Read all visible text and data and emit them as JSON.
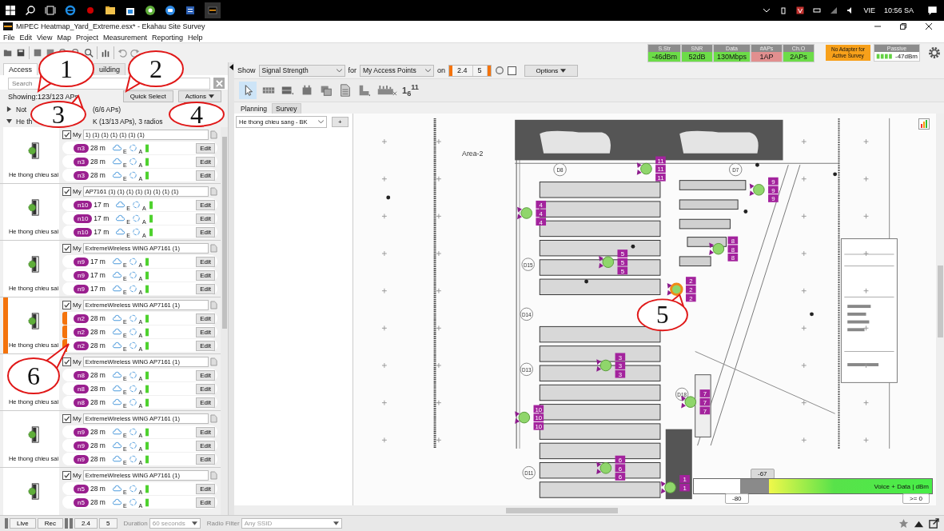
{
  "taskbar": {
    "language": "VIE",
    "clock": "10:56 SA"
  },
  "window": {
    "title": "MIPEC Heatmap_Yard_Extreme.esx* - Ekahau Site Survey"
  },
  "menu": [
    "File",
    "Edit",
    "View",
    "Map",
    "Project",
    "Measurement",
    "Reporting",
    "Help"
  ],
  "status_meters": [
    {
      "label": "S.Str",
      "value": "-46dBm",
      "color": "#6cdc48"
    },
    {
      "label": "SNR",
      "value": "52dB",
      "color": "#6cdc48"
    },
    {
      "label": "Data",
      "value": "130Mbps",
      "color": "#6cdc48"
    },
    {
      "label": "#APs",
      "value": "1AP",
      "color": "#e28f8f"
    },
    {
      "label": "Ch.O",
      "value": "2APs",
      "color": "#6cdc48"
    }
  ],
  "adapter_notice": "No Adapter for Active Survey",
  "passive": {
    "label": "Passive",
    "value": "-47dBm"
  },
  "left_panel": {
    "tabs": [
      {
        "label": "Access",
        "selected": true
      },
      {
        "label": "uilding",
        "selected": false
      }
    ],
    "search": {
      "placeholder": "Search"
    },
    "showing": "Showing:123/123 APs",
    "buttons": [
      "Quick Select",
      "Actions"
    ],
    "groups": [
      {
        "label_start": "Not",
        "label_end": "(6/6 APs)",
        "expanded": false
      },
      {
        "label_start": "He th",
        "label_end": "K (13/13 APs), 3 radios",
        "expanded": true
      }
    ],
    "aps": [
      {
        "caption": "He thong chieu sai",
        "checked": true,
        "my": "My",
        "name": "1) (1) (1) (1) (1) (1) (1)",
        "highlighted": false,
        "radios": [
          {
            "channel": "n3",
            "distance": "28 m",
            "e": "E",
            "a": "A",
            "edit": "Edit"
          },
          {
            "channel": "n3",
            "distance": "28 m",
            "e": "E",
            "a": "A",
            "edit": "Edit"
          },
          {
            "channel": "n3",
            "distance": "28 m",
            "e": "E",
            "a": "A",
            "edit": "Edit"
          }
        ]
      },
      {
        "caption": "He thong chieu sai",
        "checked": true,
        "my": "My",
        "name": "AP7161 (1) (1) (1) (1) (1) (1) (1) (1)",
        "highlighted": false,
        "radios": [
          {
            "channel": "n10",
            "distance": "17 m",
            "e": "E",
            "a": "A",
            "edit": "Edit"
          },
          {
            "channel": "n10",
            "distance": "17 m",
            "e": "E",
            "a": "A",
            "edit": "Edit"
          },
          {
            "channel": "n10",
            "distance": "17 m",
            "e": "E",
            "a": "A",
            "edit": "Edit"
          }
        ]
      },
      {
        "caption": "He thong chieu sai",
        "checked": true,
        "my": "My",
        "name": "ExtremeWireless WiNG AP7161 (1)",
        "highlighted": false,
        "radios": [
          {
            "channel": "n9",
            "distance": "17 m",
            "e": "E",
            "a": "A",
            "edit": "Edit"
          },
          {
            "channel": "n9",
            "distance": "17 m",
            "e": "E",
            "a": "A",
            "edit": "Edit"
          },
          {
            "channel": "n9",
            "distance": "17 m",
            "e": "E",
            "a": "A",
            "edit": "Edit"
          }
        ]
      },
      {
        "caption": "He thong chieu sai",
        "checked": true,
        "my": "My",
        "name": "ExtremeWireless WiNG AP7161 (1)",
        "highlighted": true,
        "radios": [
          {
            "channel": "n2",
            "distance": "28 m",
            "e": "E",
            "a": "A",
            "edit": "Edit"
          },
          {
            "channel": "n2",
            "distance": "28 m",
            "e": "E",
            "a": "A",
            "edit": "Edit"
          },
          {
            "channel": "n2",
            "distance": "28 m",
            "e": "E",
            "a": "A",
            "edit": "Edit"
          }
        ]
      },
      {
        "caption": "He thong chieu sai",
        "checked": true,
        "my": "My",
        "name": "ExtremeWireless WiNG AP7161 (1)",
        "highlighted": false,
        "radios": [
          {
            "channel": "n8",
            "distance": "28 m",
            "e": "E",
            "a": "A",
            "edit": "Edit"
          },
          {
            "channel": "n8",
            "distance": "28 m",
            "e": "E",
            "a": "A",
            "edit": "Edit"
          },
          {
            "channel": "n8",
            "distance": "28 m",
            "e": "E",
            "a": "A",
            "edit": "Edit"
          }
        ]
      },
      {
        "caption": "He thong chieu sai",
        "checked": true,
        "my": "My",
        "name": "ExtremeWireless WiNG AP7161 (1)",
        "highlighted": false,
        "radios": [
          {
            "channel": "n9",
            "distance": "28 m",
            "e": "E",
            "a": "A",
            "edit": "Edit"
          },
          {
            "channel": "n9",
            "distance": "28 m",
            "e": "E",
            "a": "A",
            "edit": "Edit"
          },
          {
            "channel": "n9",
            "distance": "28 m",
            "e": "E",
            "a": "A",
            "edit": "Edit"
          }
        ]
      },
      {
        "checked": true,
        "my": "My",
        "name": "ExtremeWireless WiNG AP7161 (1)",
        "highlighted": false,
        "radios": [
          {
            "channel": "n5",
            "distance": "28 m",
            "e": "E",
            "a": "A",
            "edit": "Edit"
          },
          {
            "channel": "n5",
            "distance": "28 m",
            "e": "E",
            "a": "A",
            "edit": "Edit"
          }
        ]
      }
    ]
  },
  "view_bar": {
    "show_label": "Show",
    "show_value": "Signal Strength",
    "for_label": "for",
    "for_value": "My Access Points",
    "on_label": "on",
    "bands": [
      "2.4",
      "5"
    ],
    "checked": false,
    "options": "Options"
  },
  "channel_tool": "1$_{6}$$^{11}$",
  "map_tabs": [
    {
      "label": "Planning",
      "selected": false
    },
    {
      "label": "Survey",
      "selected": true
    }
  ],
  "floor": {
    "value": "He thong chieu sang - BK",
    "add": "+"
  },
  "map": {
    "area": "Area-2",
    "doors": [
      "D8",
      "D7",
      "D15",
      "D14",
      "D13",
      "D11",
      "D18"
    ],
    "aps": [
      {
        "labels": [
          "11",
          "11",
          "11"
        ],
        "selected": false
      },
      {
        "labels": [
          "9",
          "9",
          "9"
        ],
        "selected": false
      },
      {
        "labels": [
          "4",
          "4",
          "4"
        ],
        "selected": false
      },
      {
        "labels": [
          "5",
          "5",
          "5"
        ],
        "selected": false
      },
      {
        "labels": [
          "8",
          "8",
          "8"
        ],
        "selected": false
      },
      {
        "labels": [
          "2",
          "2",
          "2"
        ],
        "selected": true
      },
      {
        "labels": [
          "3",
          "3",
          "3"
        ],
        "selected": false
      },
      {
        "labels": [
          "10",
          "10",
          "10"
        ],
        "selected": false
      },
      {
        "labels": [
          "7",
          "7",
          "7"
        ],
        "selected": false
      },
      {
        "labels": [
          "6",
          "6",
          "6"
        ],
        "selected": false
      },
      {
        "labels": [
          "1",
          "1"
        ],
        "selected": false
      }
    ]
  },
  "legend": {
    "threshold": "-67",
    "min": "-80",
    "max": ">= 0",
    "title": "Voice + Data | dBm"
  },
  "callouts": [
    "1",
    "2",
    "3",
    "4",
    "5",
    "6"
  ],
  "status_bar": {
    "live": "Live",
    "rec": "Rec",
    "bands": [
      "2.4",
      "5"
    ],
    "duration_label": "Duration",
    "duration": "60 seconds",
    "filter_label": "Radio Filter",
    "filter": "Any SSID"
  }
}
